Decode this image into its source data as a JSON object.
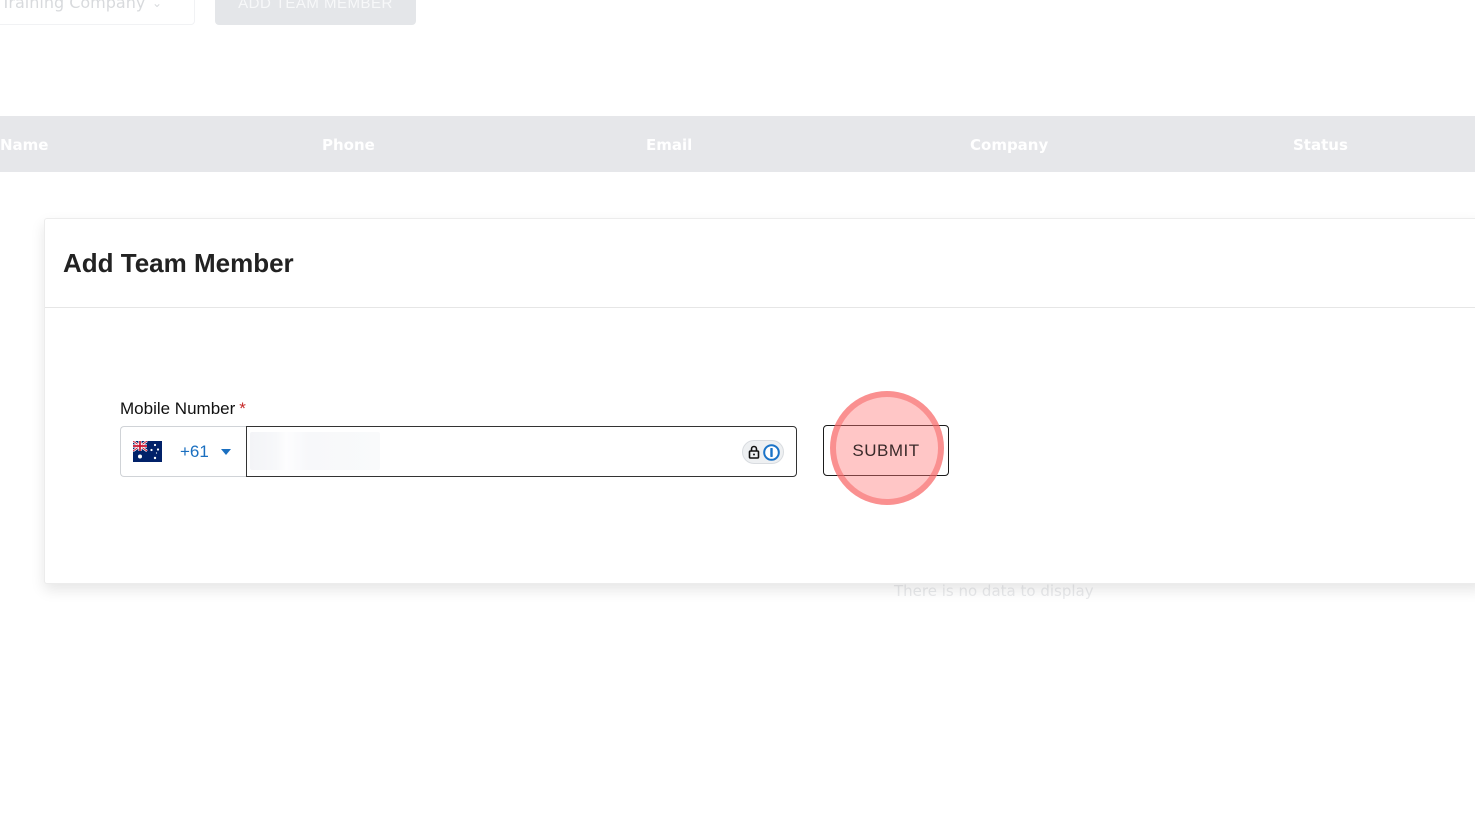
{
  "background": {
    "company_select": {
      "value": "Training Company"
    },
    "add_button": {
      "label": "ADD TEAM MEMBER"
    },
    "table": {
      "columns": [
        "Name",
        "Phone",
        "Email",
        "Company",
        "Status"
      ]
    },
    "empty_text": "There is no data to display"
  },
  "modal": {
    "title": "Add Team Member",
    "mobile_field": {
      "label": "Mobile Number",
      "required_marker": "*",
      "country_code": "+61",
      "country_flag_icon": "australia-flag-icon",
      "value": ""
    },
    "submit_label": "SUBMIT"
  },
  "colors": {
    "accent_blue": "#1a6fc0",
    "required_red": "#c62828",
    "click_highlight": "#ff7878"
  }
}
